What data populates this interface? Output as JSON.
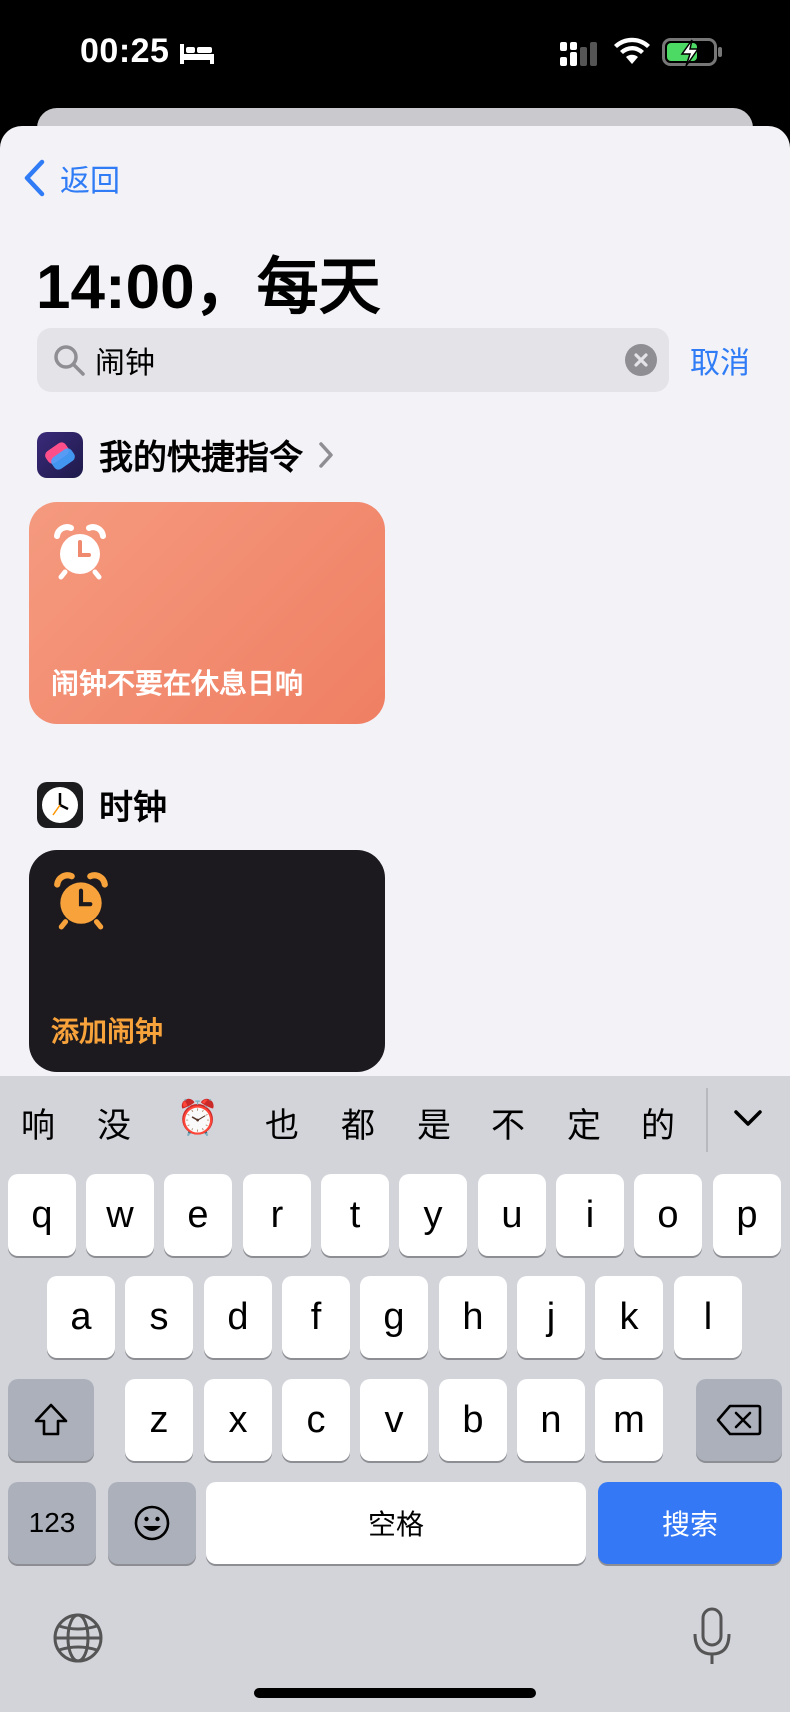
{
  "status_bar": {
    "time": "00:25"
  },
  "nav": {
    "back_label": "返回"
  },
  "page": {
    "title": "14:00，每天"
  },
  "search": {
    "value": "闹钟",
    "cancel_label": "取消"
  },
  "sections": {
    "shortcuts": {
      "title": "我的快捷指令",
      "tile_label": "闹钟不要在休息日响"
    },
    "clock": {
      "title": "时钟",
      "tile_label": "添加闹钟"
    }
  },
  "keyboard": {
    "candidates": [
      "响",
      "没",
      "⏰",
      "也",
      "都",
      "是",
      "不",
      "定",
      "的"
    ],
    "row1": [
      "q",
      "w",
      "e",
      "r",
      "t",
      "y",
      "u",
      "i",
      "o",
      "p"
    ],
    "row2": [
      "a",
      "s",
      "d",
      "f",
      "g",
      "h",
      "j",
      "k",
      "l"
    ],
    "row3": [
      "z",
      "x",
      "c",
      "v",
      "b",
      "n",
      "m"
    ],
    "numbers_label": "123",
    "space_label": "空格",
    "search_label": "搜索"
  },
  "colors": {
    "accent": "#2f7cf6",
    "shortcut_tile": "#f08a6e",
    "clock_tile": "#1c1a1f",
    "clock_label": "#f7a23a",
    "search_key": "#3478f6"
  }
}
